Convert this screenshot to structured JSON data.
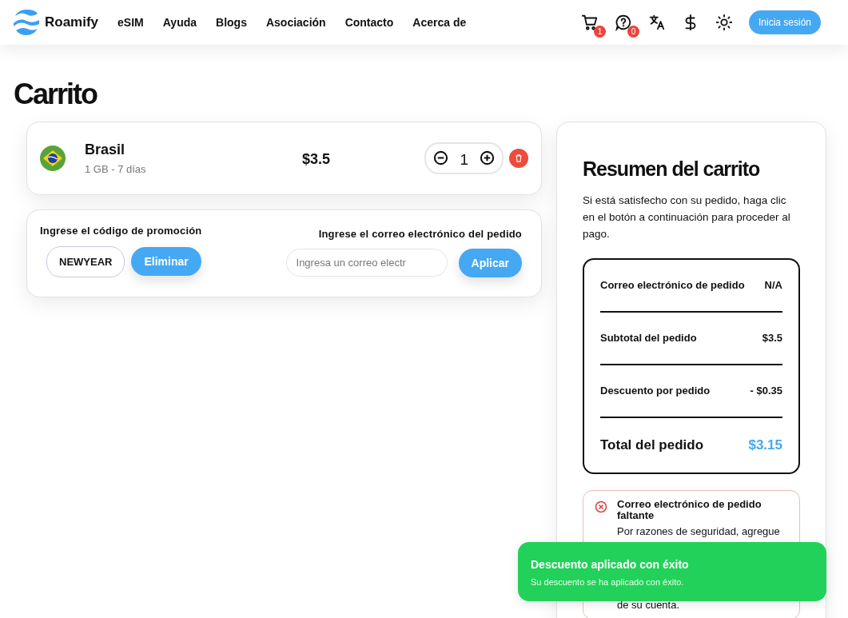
{
  "header": {
    "brand": "Roamify",
    "nav": [
      "eSIM",
      "Ayuda",
      "Blogs",
      "Asociación",
      "Contacto",
      "Acerca de"
    ],
    "cart_badge": "1",
    "support_badge": "0",
    "login_button": "Inicia sesión"
  },
  "page_title": "Carrito",
  "cart_items": [
    {
      "name": "Brasil",
      "details": "1 GB - 7 días",
      "price": "$3.5",
      "quantity": "1"
    }
  ],
  "promo": {
    "label": "Ingrese el código de promoción",
    "code": "NEWYEAR",
    "button": "Eliminar"
  },
  "order_email": {
    "label": "Ingrese el correo electrónico del pedido",
    "placeholder": "Ingresa un correo electr",
    "button": "Aplicar"
  },
  "summary": {
    "title": "Resumen del carrito",
    "intro": "Si está satisfecho con su pedido, haga clic en el botón a continuación para proceder al pago.",
    "rows": [
      {
        "label": "Correo electrónico de pedido",
        "value": "N/A"
      },
      {
        "label": "Subtotal del pedido",
        "value": "$3.5"
      },
      {
        "label": "Descuento por pedido",
        "value": "- $0.35"
      }
    ],
    "total": {
      "label": "Total del pedido",
      "value": "$3.15"
    },
    "alert": {
      "title": "Correo electrónico de pedido faltante",
      "lines": [
        "Por razones de seguridad, agregue",
        "de su cuenta."
      ]
    }
  },
  "toast": {
    "title": "Descuento aplicado con éxito",
    "message": "Su descuento se ha aplicado con éxito."
  }
}
